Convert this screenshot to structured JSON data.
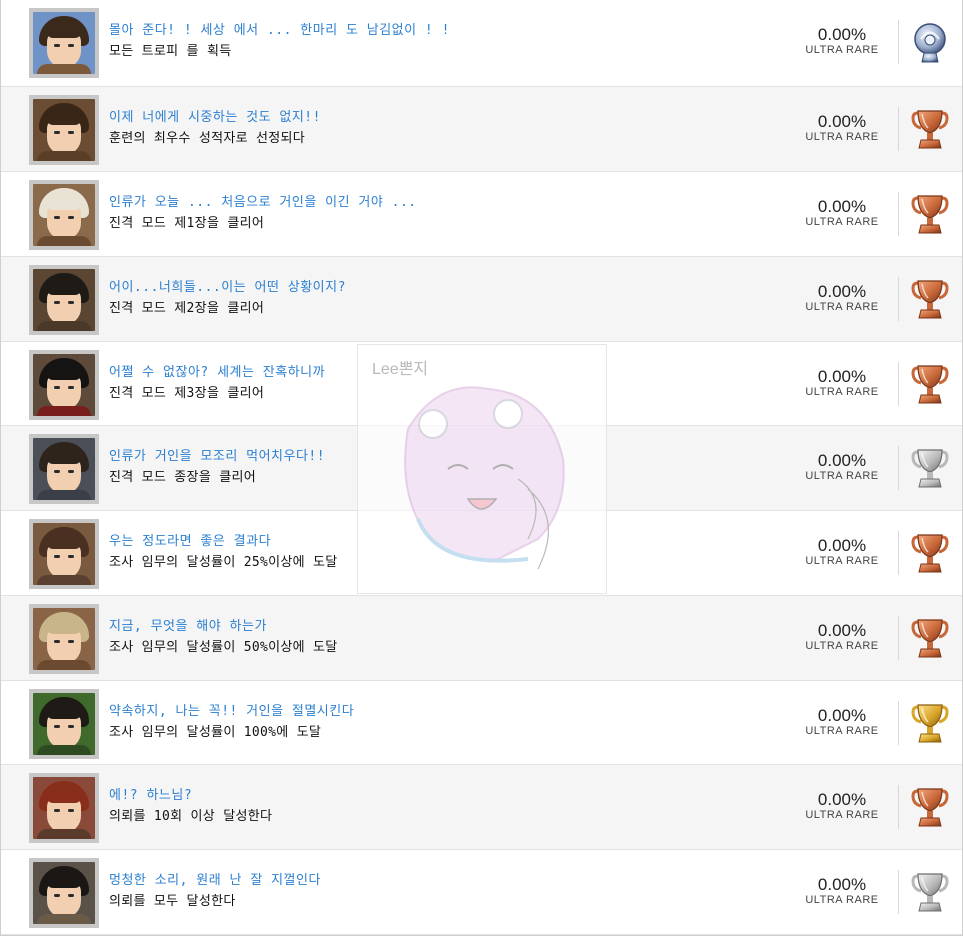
{
  "trophies": [
    {
      "title": "몰아 준다! ! 세상 에서 ... 한마리 도 남김없이 ! !",
      "description": "모든 트로피 를 획득",
      "percent": "0.00%",
      "rarity": "ULTRA RARE",
      "grade": "platinum",
      "avatar_icon": "blue-sky-hero-portrait-icon"
    },
    {
      "title": "이제 너에게 시중하는 것도 없지!!",
      "description": "훈련의 최우수 성적자로 선정되다",
      "percent": "0.00%",
      "rarity": "ULTRA RARE",
      "grade": "bronze",
      "avatar_icon": "brown-hair-cadet-portrait-icon"
    },
    {
      "title": "인류가 오늘 ... 처음으로 거인을 이긴 거야 ...",
      "description": "진격 모드 제1장을 클리어",
      "percent": "0.00%",
      "rarity": "ULTRA RARE",
      "grade": "bronze",
      "avatar_icon": "blond-hair-cadet-portrait-icon"
    },
    {
      "title": "어이...너희들...이는 어떤 상황이지?",
      "description": "진격 모드 제2장을 클리어",
      "percent": "0.00%",
      "rarity": "ULTRA RARE",
      "grade": "bronze",
      "avatar_icon": "dark-hair-captain-portrait-icon"
    },
    {
      "title": "어쩔 수 없잖아? 세계는 잔혹하니까",
      "description": "진격 모드 제3장을 클리어",
      "percent": "0.00%",
      "rarity": "ULTRA RARE",
      "grade": "bronze",
      "avatar_icon": "black-hair-soldier-portrait-icon"
    },
    {
      "title": "인류가 거인을 모조리 먹어치우다!!",
      "description": "진격 모드 종장을 클리어",
      "percent": "0.00%",
      "rarity": "ULTRA RARE",
      "grade": "silver",
      "avatar_icon": "brown-hair-soldier-portrait-icon"
    },
    {
      "title": "우는 정도라면 좋은 결과다",
      "description": "조사 임무의 달성률이 25%이상에 도달",
      "percent": "0.00%",
      "rarity": "ULTRA RARE",
      "grade": "bronze",
      "avatar_icon": "ponytail-scout-portrait-icon"
    },
    {
      "title": "지금, 무엇을 해야 하는가",
      "description": "조사 임무의 달성률이 50%이상에 도달",
      "percent": "0.00%",
      "rarity": "ULTRA RARE",
      "grade": "bronze",
      "avatar_icon": "ash-hair-scout-portrait-icon"
    },
    {
      "title": "약속하지, 나는 꼭!! 거인을 절멸시킨다",
      "description": "조사 임무의 달성률이 100%에 도달",
      "percent": "0.00%",
      "rarity": "ULTRA RARE",
      "grade": "gold",
      "avatar_icon": "forest-captain-portrait-icon"
    },
    {
      "title": "에!? 하느님?",
      "description": "의뢰를 10회 이상 달성한다",
      "percent": "0.00%",
      "rarity": "ULTRA RARE",
      "grade": "bronze",
      "avatar_icon": "red-hair-scout-portrait-icon"
    },
    {
      "title": "멍청한 소리, 원래 난 잘 지껄인다",
      "description": "의뢰를 모두 달성한다",
      "percent": "0.00%",
      "rarity": "ULTRA RARE",
      "grade": "silver",
      "avatar_icon": "captain-portrait-icon"
    }
  ],
  "avatar_palette": [
    {
      "bg": "#6f93c7",
      "hair": "#3b2a1c",
      "collar": "#7a5a3a"
    },
    {
      "bg": "#6b4d33",
      "hair": "#3a2617",
      "collar": "#5a3e28"
    },
    {
      "bg": "#8a6a4a",
      "hair": "#e8e3d4",
      "collar": "#6a4a30"
    },
    {
      "bg": "#5a4633",
      "hair": "#1e1a16",
      "collar": "#4a3828"
    },
    {
      "bg": "#5d4a3a",
      "hair": "#161313",
      "collar": "#7a1d1d"
    },
    {
      "bg": "#4a4f58",
      "hair": "#2e241b",
      "collar": "#3a3f48"
    },
    {
      "bg": "#7a5a3e",
      "hair": "#4a3020",
      "collar": "#5a4030"
    },
    {
      "bg": "#8a6446",
      "hair": "#c9b58a",
      "collar": "#6b4a30"
    },
    {
      "bg": "#3f6a2c",
      "hair": "#1e1a16",
      "collar": "#2e4a22"
    },
    {
      "bg": "#8a4a3a",
      "hair": "#8a2e1c",
      "collar": "#5a3a2a"
    },
    {
      "bg": "#5a5148",
      "hair": "#1b1715",
      "collar": "#6a5a48"
    }
  ],
  "trophy_colors": {
    "bronze": {
      "light": "#f2a67a",
      "mid": "#c8683a",
      "dark": "#7a3416"
    },
    "silver": {
      "light": "#f4f4f4",
      "mid": "#b9b9b9",
      "dark": "#6e6e6e"
    },
    "gold": {
      "light": "#ffe38a",
      "mid": "#d9a52a",
      "dark": "#8a5e0c"
    },
    "platinum": {
      "light": "#eef3fb",
      "mid": "#9fb1cf",
      "dark": "#3a4f78"
    }
  },
  "watermark": {
    "text": "Lee뽄지",
    "icon": "anime-girl-watermark-icon"
  }
}
